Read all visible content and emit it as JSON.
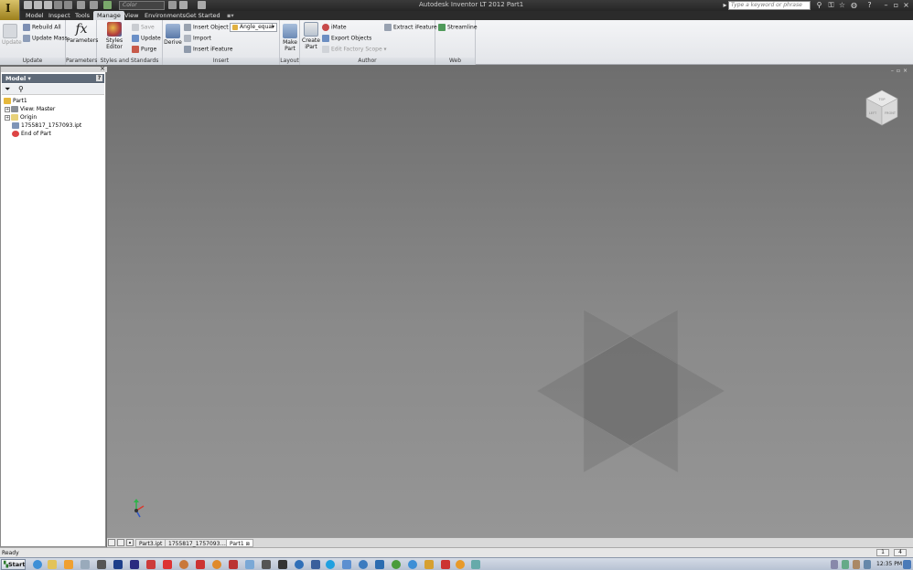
{
  "titlebar": {
    "app_button_letter": "I",
    "color_placeholder": "Color",
    "title": "Autodesk Inventor LT 2012    Part1",
    "search_placeholder": "Type a keyword or phrase"
  },
  "menu": {
    "tabs": [
      "Model",
      "Inspect",
      "Tools",
      "Manage",
      "View",
      "Environments",
      "Get Started"
    ],
    "active": "Manage"
  },
  "ribbon": {
    "update_panel": {
      "label": "Update",
      "update": "Update",
      "rebuild_all": "Rebuild All",
      "update_mass": "Update Mass"
    },
    "parameters_panel": {
      "label": "Parameters",
      "parameters": "Parameters"
    },
    "styles_panel": {
      "label": "Styles and Standards",
      "styles_editor": "Styles Editor",
      "save": "Save",
      "update": "Update",
      "purge": "Purge"
    },
    "insert_panel": {
      "label": "Insert",
      "derive": "Derive",
      "insert_object": "Insert Object",
      "import": "Import",
      "insert_ifeature": "Insert iFeature",
      "dropdown_value": "Angle_equal"
    },
    "layout_panel": {
      "label": "Layout",
      "make_part_1": "Make",
      "make_part_2": "Part"
    },
    "author_panel": {
      "label": "Author",
      "create_ipart_1": "Create",
      "create_ipart_2": "iPart",
      "imate": "iMate",
      "export_objects": "Export Objects",
      "edit_factory_scope": "Edit Factory Scope",
      "extract_ifeature": "Extract iFeature"
    },
    "web_panel": {
      "label": "Web",
      "streamline": "Streamline"
    }
  },
  "browser": {
    "header": "Model",
    "tree": [
      {
        "label": "Part1"
      },
      {
        "label": "View: Master"
      },
      {
        "label": "Origin"
      },
      {
        "label": "1755817_1757093.ipt"
      },
      {
        "label": "End of Part"
      }
    ]
  },
  "viewcube": {
    "top": "TOP",
    "left": "LEFT",
    "front": "FRONT"
  },
  "doc_tabs": [
    "Part3.ipt",
    "1755817_1757093....ipt",
    "Part1"
  ],
  "active_doc": "Part1",
  "status": {
    "text": "Ready",
    "box1": "1",
    "box2": "4"
  },
  "taskbar": {
    "start": "Start",
    "clock": "12:35 PM"
  },
  "colors": {
    "viewport_top": "#6e6e6e",
    "viewport_bottom": "#969696",
    "browser_header": "#5f6a78"
  }
}
